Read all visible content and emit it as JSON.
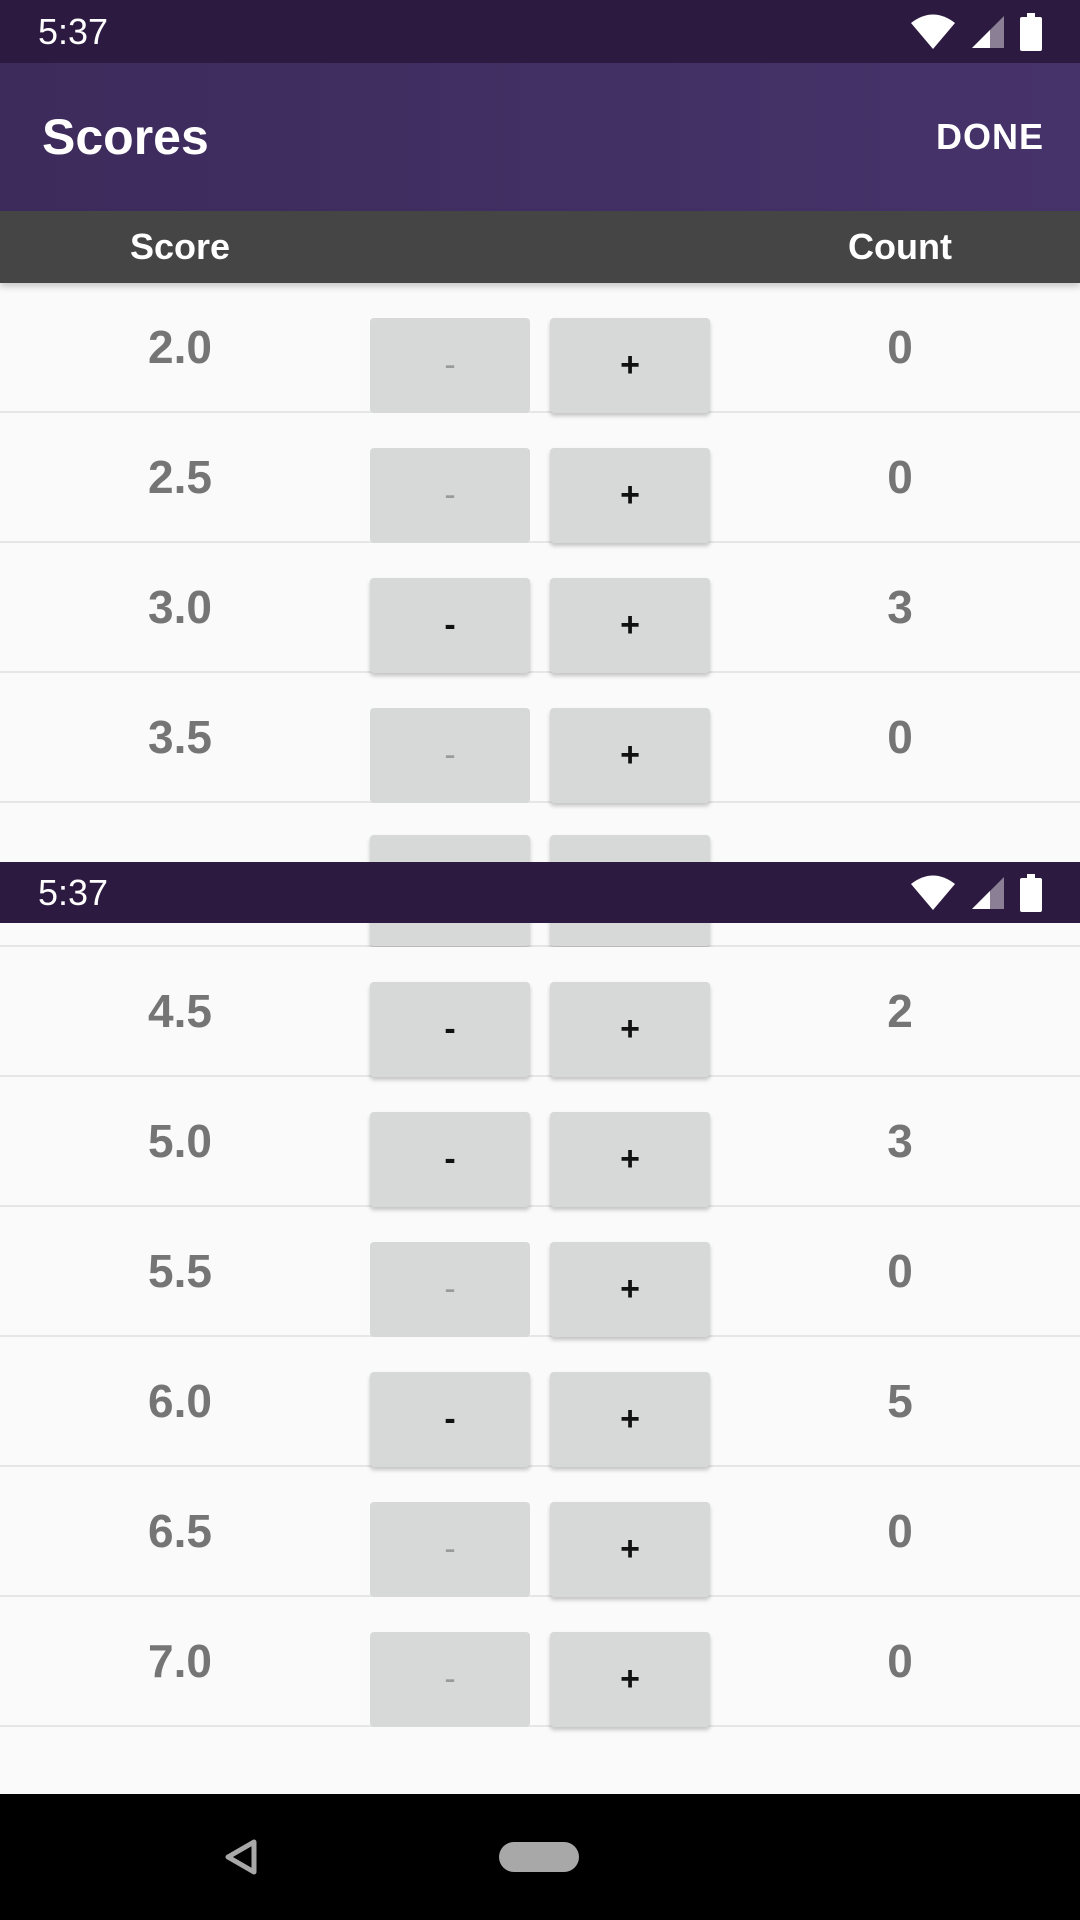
{
  "status_bar": {
    "time": "5:37",
    "icons": [
      "wifi-icon",
      "signal-icon",
      "battery-icon"
    ]
  },
  "app_bar": {
    "title": "Scores",
    "action_label": "DONE"
  },
  "table_header": {
    "score_label": "Score",
    "count_label": "Count"
  },
  "buttons": {
    "minus_label": "-",
    "plus_label": "+"
  },
  "rows_top": [
    {
      "score": "2.0",
      "count": "0",
      "minus_enabled": false
    },
    {
      "score": "2.5",
      "count": "0",
      "minus_enabled": false
    },
    {
      "score": "3.0",
      "count": "3",
      "minus_enabled": true
    },
    {
      "score": "3.5",
      "count": "0",
      "minus_enabled": false
    }
  ],
  "rows_bottom": [
    {
      "score": "4.5",
      "count": "2",
      "minus_enabled": true
    },
    {
      "score": "5.0",
      "count": "3",
      "minus_enabled": true
    },
    {
      "score": "5.5",
      "count": "0",
      "minus_enabled": false
    },
    {
      "score": "6.0",
      "count": "5",
      "minus_enabled": true
    },
    {
      "score": "6.5",
      "count": "0",
      "minus_enabled": false
    },
    {
      "score": "7.0",
      "count": "0",
      "minus_enabled": false
    }
  ],
  "nav_bar": {
    "icons": [
      "back-icon",
      "home-pill-icon"
    ]
  },
  "colors": {
    "status_bar": "#2d1a40",
    "app_bar": "#46336a",
    "table_header": "#454545",
    "button": "#d7d8d8",
    "text_value": "#757575"
  }
}
